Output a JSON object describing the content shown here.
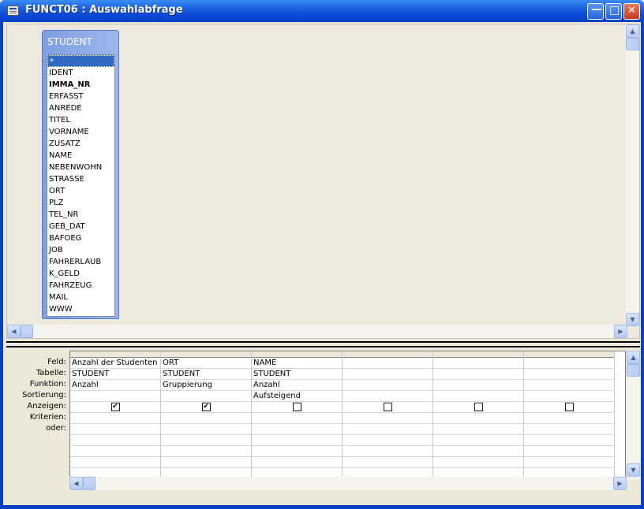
{
  "window": {
    "title": "FUNCT06 : Auswahlabfrage",
    "buttons": {
      "minimize": "—",
      "maximize": "□",
      "close": "✕"
    }
  },
  "table": {
    "name": "STUDENT",
    "fields": [
      "*",
      "IDENT",
      "IMMA_NR",
      "ERFASST",
      "ANREDE",
      "TITEL",
      "VORNAME",
      "ZUSATZ",
      "NAME",
      "NEBENWOHN",
      "STRASSE",
      "ORT",
      "PLZ",
      "TEL_NR",
      "GEB_DAT",
      "BAFOEG",
      "JOB",
      "FAHRERLAUB",
      "K_GELD",
      "FAHRZEUG",
      "MAIL",
      "WWW"
    ],
    "selected_field": "*",
    "primary_key": "IMMA_NR"
  },
  "grid": {
    "row_labels": {
      "feld": "Feld:",
      "tabelle": "Tabelle:",
      "funktion": "Funktion:",
      "sortierung": "Sortierung:",
      "anzeigen": "Anzeigen:",
      "kriterien": "Kriterien:",
      "oder": "oder:"
    },
    "columns": [
      {
        "feld": "Anzahl der Studenten",
        "tabelle": "STUDENT",
        "funktion": "Anzahl",
        "sortierung": "",
        "anzeigen": true
      },
      {
        "feld": "ORT",
        "tabelle": "STUDENT",
        "funktion": "Gruppierung",
        "sortierung": "",
        "anzeigen": true
      },
      {
        "feld": "NAME",
        "tabelle": "STUDENT",
        "funktion": "Anzahl",
        "sortierung": "Aufsteigend",
        "anzeigen": false
      },
      {
        "feld": "",
        "tabelle": "",
        "funktion": "",
        "sortierung": "",
        "anzeigen": false
      },
      {
        "feld": "",
        "tabelle": "",
        "funktion": "",
        "sortierung": "",
        "anzeigen": false
      },
      {
        "feld": "",
        "tabelle": "",
        "funktion": "",
        "sortierung": "",
        "anzeigen": false
      }
    ]
  },
  "icons": {
    "check": "✔",
    "scroll_up": "▲",
    "scroll_down": "▼",
    "scroll_left": "◀",
    "scroll_right": "▶"
  },
  "colors": {
    "title_bar": "#0a48d6",
    "table_box": "#7f9fe2",
    "selection": "#316ac5"
  }
}
